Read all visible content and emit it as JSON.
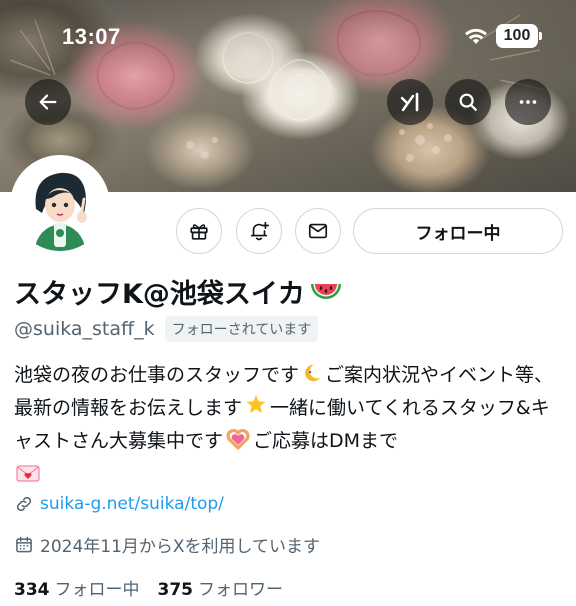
{
  "status_bar": {
    "time": "13:07",
    "battery": "100"
  },
  "header": {
    "back_icon": "arrow-left-icon",
    "grok_icon": "grok-icon",
    "search_icon": "search-icon",
    "more_icon": "more-horizontal-icon"
  },
  "actions": {
    "gift_icon": "gift-icon",
    "notify_icon": "bell-plus-icon",
    "mail_icon": "mail-icon",
    "follow_label": "フォロー中"
  },
  "profile": {
    "name": "スタッフK@池袋スイカ",
    "handle": "@suika_staff_k",
    "follows_you": "フォローされています",
    "bio_parts": [
      "池袋の夜のお仕事のスタッフです",
      "ご案内状況やイベント等、最新の情報をお伝えします",
      "一緒に働いてくれるスタッフ&キャストさん大募集中です",
      "ご応募はDMまで"
    ],
    "website": "suika-g.net/suika/top/",
    "joined": "2024年11月からXを利用しています"
  },
  "stats": {
    "following_count": "334",
    "following_label": "フォロー中",
    "followers_count": "375",
    "followers_label": "フォロワー"
  },
  "colors": {
    "accent": "#1d9bf0",
    "text": "#0f1419",
    "muted": "#536471",
    "border": "#cfd9de"
  }
}
